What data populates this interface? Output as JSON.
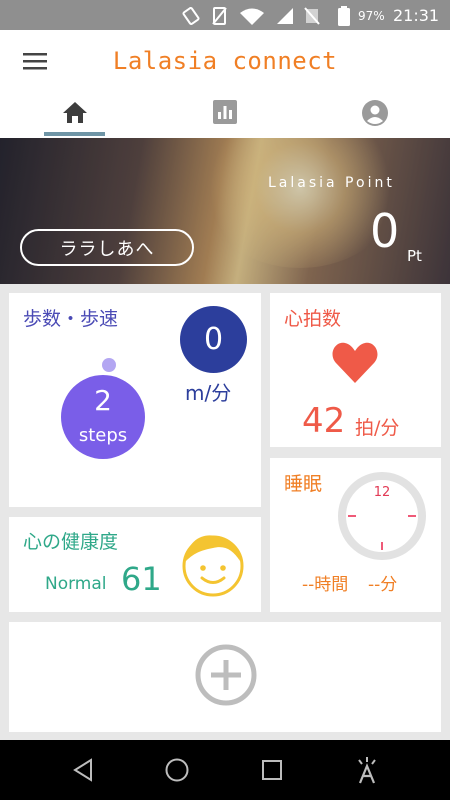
{
  "status_bar": {
    "battery_percent": "97%",
    "time": "21:31"
  },
  "app_bar": {
    "title": "Lalasia connect"
  },
  "tabs": [
    {
      "name": "home",
      "icon": "home-icon",
      "active": true
    },
    {
      "name": "chart",
      "icon": "bar-chart-icon",
      "active": false
    },
    {
      "name": "account",
      "icon": "account-circle-icon",
      "active": false
    }
  ],
  "hero": {
    "button_label": "ララしあへ",
    "point_label": "Lalasia Point",
    "point_value": "0",
    "point_unit": "Pt"
  },
  "steps_card": {
    "title": "歩数・歩速",
    "speed_value": "0",
    "speed_unit": "m/分",
    "steps_value": "2",
    "steps_label": "steps"
  },
  "heart_card": {
    "title": "心拍数",
    "rate_value": "42",
    "rate_unit": "拍/分"
  },
  "mind_card": {
    "title": "心の健康度",
    "status": "Normal",
    "score": "61"
  },
  "sleep_card": {
    "title": "睡眠",
    "clock_label": "12",
    "hours_text": "--時間",
    "minutes_text": "--分"
  },
  "colors": {
    "accent_orange": "#f07f25",
    "steps_blue": "#2c3e9c",
    "steps_purple": "#7a5ee8",
    "heart_red": "#ef5a48",
    "mind_green": "#2fa889",
    "face_yellow": "#f4c431"
  }
}
